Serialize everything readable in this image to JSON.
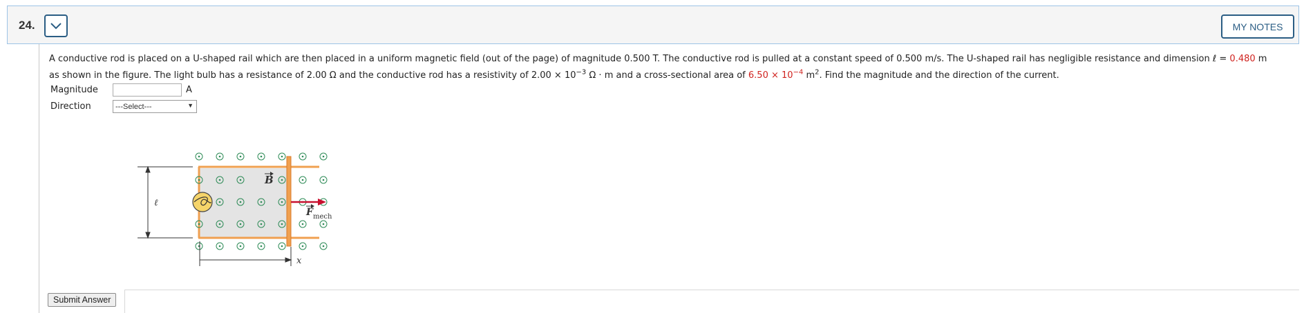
{
  "question": {
    "number": "24.",
    "notes_label": "MY NOTES",
    "text_line1_a": "A conductive rod is placed on a U-shaped rail which are then placed in a uniform magnetic field (out of the page) of magnitude 0.500 T. The conductive rod is pulled at a constant speed of 0.500 m/s. The U-shaped rail has negligible resistance and dimension ℓ = ",
    "ell_value": "0.480",
    "text_line1_b": " m",
    "text_line2_a": "as shown in the figure. The light bulb has a resistance of 2.00 Ω and the conductive rod has a resistivity of 2.00 × 10",
    "resistivity_exp": "−3",
    "text_line2_b": " Ω · m and a cross-sectional area of ",
    "area_value": "6.50 × 10",
    "area_exp": "−4",
    "text_line2_c": " m",
    "area_unit_exp": "2",
    "text_line2_d": ". Find the magnitude and the direction of the current."
  },
  "answers": {
    "magnitude_label": "Magnitude",
    "magnitude_value": "",
    "magnitude_unit": "A",
    "direction_label": "Direction",
    "direction_selected": "---Select---"
  },
  "figure": {
    "field_label": "B",
    "length_label": "ℓ",
    "force_label": "F",
    "force_subscript": "mech",
    "position_label": "x"
  },
  "submit_label": "Submit Answer",
  "colors": {
    "accent": "#2a5d84",
    "highlight": "#d0231f",
    "rail": "#f0a050",
    "field_dot": "#2e8b57"
  }
}
